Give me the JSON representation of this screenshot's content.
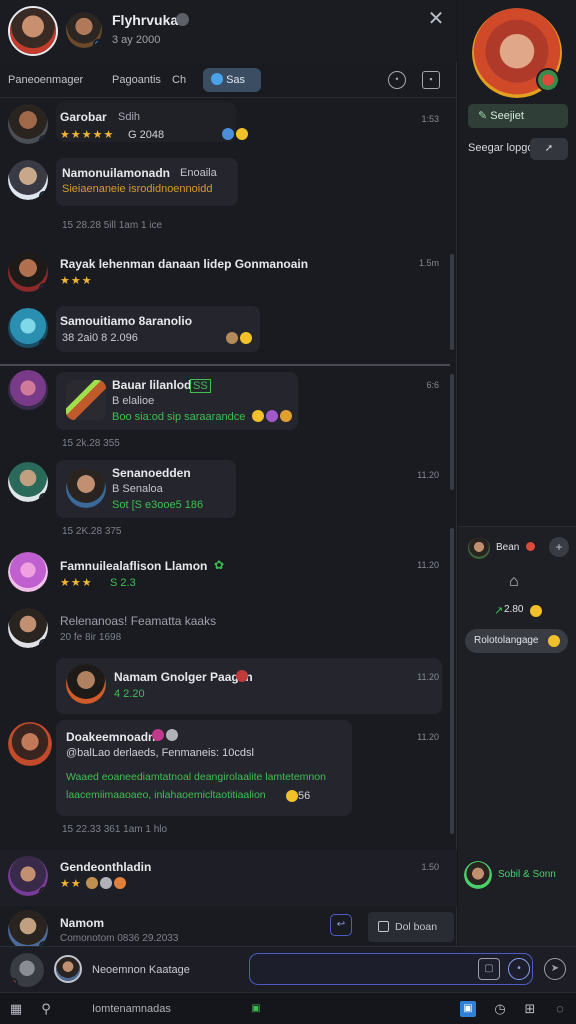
{
  "header": {
    "title": "Flyhrvuka",
    "subtitle": "3 ay 2000",
    "close_glyph": "✕"
  },
  "filterbar": {
    "label": "Paneoenmager",
    "tab_1": "Pagoantis",
    "tab_2": "Ch",
    "active_tab": "Sas",
    "icon_1": "info-icon",
    "icon_2": "square-icon"
  },
  "messages": [
    {
      "name": "Garobar",
      "tag": "Sdih",
      "rating": "★★★★★",
      "line": "G 2048",
      "time": "1:53"
    },
    {
      "name": "Namonuilamonadn",
      "tag": "Enoaila",
      "line": "Sieiaenaneie isrodidnoennoidd",
      "meta": "15  28.28 5ill 1am 1 ice",
      "time": ""
    },
    {
      "name": "Rayak lehenman danaan lidep Gonmanoain",
      "rating": "★★★",
      "time": "1.5m"
    },
    {
      "name": "Samouitiamo 8aranolio",
      "line": "38  2ai0 8 2.096",
      "time": ""
    },
    {
      "name": "Bauar lilanlod",
      "tag": "SS",
      "line_1": "B elalioe",
      "line_2": "Boo sia:od sip saraarandce",
      "meta": "15  2k.28 355",
      "time": "6:6"
    },
    {
      "name": "Senanoedden",
      "line_1": "B Senaloa",
      "line_2": "Sot  [S  e3ooe5 186",
      "meta": "15  2K.28 375",
      "time": "11.20"
    },
    {
      "name": "Famnuilealaflison Llamon",
      "rating": "★★★",
      "line": "S 2.3",
      "time": "11.20"
    },
    {
      "name": "Relenanoas! Feamatta kaaks",
      "line": "20  fe 8ir 1698",
      "time": ""
    },
    {
      "name": "Namam Gnolger Paagan",
      "line": "4 2.20",
      "time": "11.20"
    },
    {
      "name": "Doakeemnoadn",
      "line_1": "@balLao derlaeds, Fenmaneis: 10cdsl",
      "line_2": "Waaed eoaneediamtatnoal deangirolaalite lamtetemnon",
      "line_3": "laacemiimaaoaeo, inlahaoemicltaotitiaalion",
      "line_3_num": "56",
      "meta": "15  22.33 361 1am 1 hlo",
      "time": "11.20"
    },
    {
      "name": "Gendeonthladin",
      "rating": "★★",
      "time": "1.50"
    },
    {
      "name": "Namom",
      "line": "Comonotom 0836 29.2033",
      "time": ""
    }
  ],
  "composer": {
    "label": "Neoemnon Kaatage",
    "chip": "Dol boan"
  },
  "toolbar": {
    "text": "Iomtenamnadas"
  },
  "side": {
    "button": "Seejiet",
    "label": "Seegar lopgo",
    "chip": "",
    "bottom_title": "Bean",
    "bottom_value": "2.80",
    "pill": "Rolotolangage",
    "footer": "Sobil & Sonn"
  },
  "colors": {
    "accent": "#3fbf52",
    "star": "#f2b531",
    "active_tab": "#3a4d63",
    "composer_border": "#4b5cc4"
  }
}
